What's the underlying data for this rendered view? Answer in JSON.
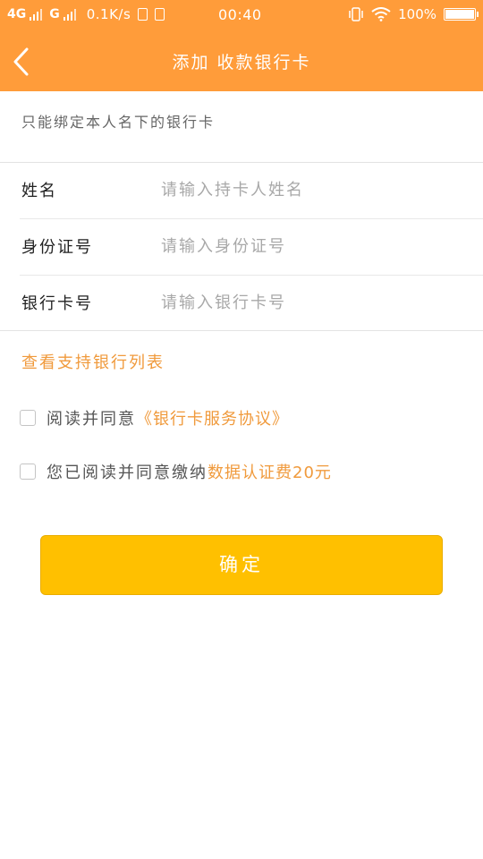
{
  "status_bar": {
    "network_1": "4G",
    "network_2": "G",
    "speed": "0.1K/s",
    "time": "00:40",
    "battery_text": "100%"
  },
  "header": {
    "title": "添加 收款银行卡"
  },
  "hint": "只能绑定本人名下的银行卡",
  "form": {
    "name_label": "姓名",
    "name_placeholder": "请输入持卡人姓名",
    "id_label": "身份证号",
    "id_placeholder": "请输入身份证号",
    "card_label": "银行卡号",
    "card_placeholder": "请输入银行卡号"
  },
  "supported_banks_link": "查看支持银行列表",
  "agreement_1": {
    "text": "阅读并同意",
    "link": "《银行卡服务协议》",
    "checked": false
  },
  "agreement_2": {
    "text": "您已阅读并同意缴纳",
    "link": "数据认证费20元",
    "checked": false
  },
  "confirm_label": "确定",
  "colors": {
    "brand_orange": "#ff9c3a",
    "link_orange": "#f09a3c",
    "button_yellow": "#ffc000"
  }
}
